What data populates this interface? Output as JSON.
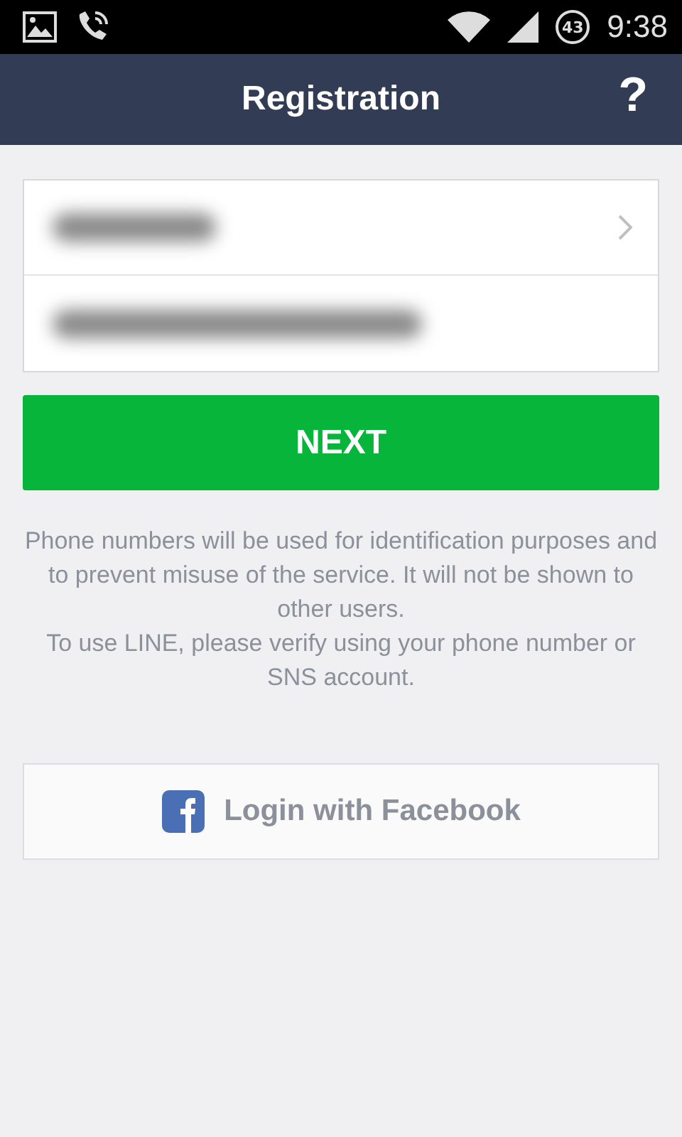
{
  "status_bar": {
    "battery": "43",
    "time": "9:38"
  },
  "header": {
    "title": "Registration",
    "help": "?"
  },
  "form": {
    "country": {
      "has_chevron": true
    }
  },
  "next_button": "NEXT",
  "notice": [
    "Phone numbers will be used for identification purposes and to prevent misuse of the service. It will not be shown to other users.",
    "To use LINE, please verify using your phone number or SNS account."
  ],
  "facebook_button": "Login with Facebook"
}
